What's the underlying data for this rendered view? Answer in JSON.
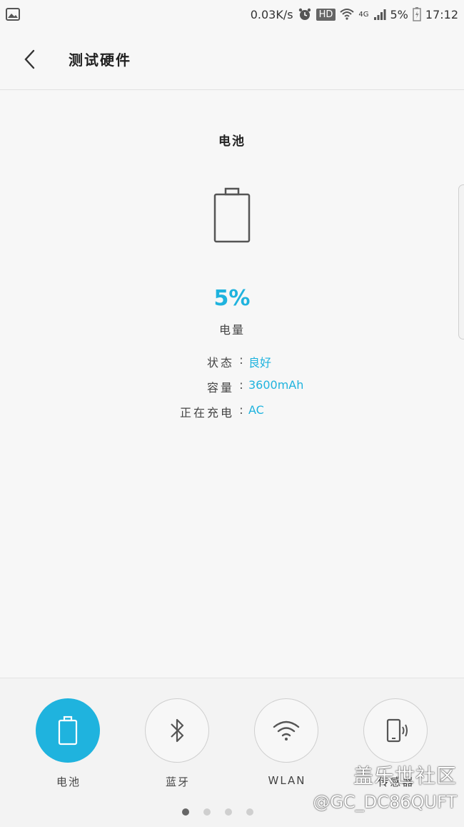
{
  "status_bar": {
    "speed": "0.03K/s",
    "hd": "HD",
    "network": "4G",
    "battery_percent": "5%",
    "time": "17:12"
  },
  "header": {
    "title": "测试硬件"
  },
  "main": {
    "section_title": "电池",
    "percent": "5%",
    "percent_label": "电量",
    "info": [
      {
        "label": "状态",
        "colon": ":",
        "value": "良好"
      },
      {
        "label": "容量",
        "colon": ":",
        "value": "3600mAh"
      },
      {
        "label": "正在充电",
        "colon": ":",
        "value": "AC"
      }
    ]
  },
  "features": [
    {
      "label": "电池",
      "icon": "battery-icon",
      "active": true
    },
    {
      "label": "蓝牙",
      "icon": "bluetooth-icon",
      "active": false
    },
    {
      "label": "WLAN",
      "icon": "wifi-icon",
      "active": false
    },
    {
      "label": "传感器",
      "icon": "phone-vibrate-icon",
      "active": false
    }
  ],
  "pagination": {
    "count": 4,
    "active_index": 0
  },
  "watermark": {
    "line1": "盖乐世社区",
    "line2": "@GC_DC86QUFT"
  },
  "colors": {
    "accent": "#1fb3de",
    "background": "#f7f7f7"
  }
}
